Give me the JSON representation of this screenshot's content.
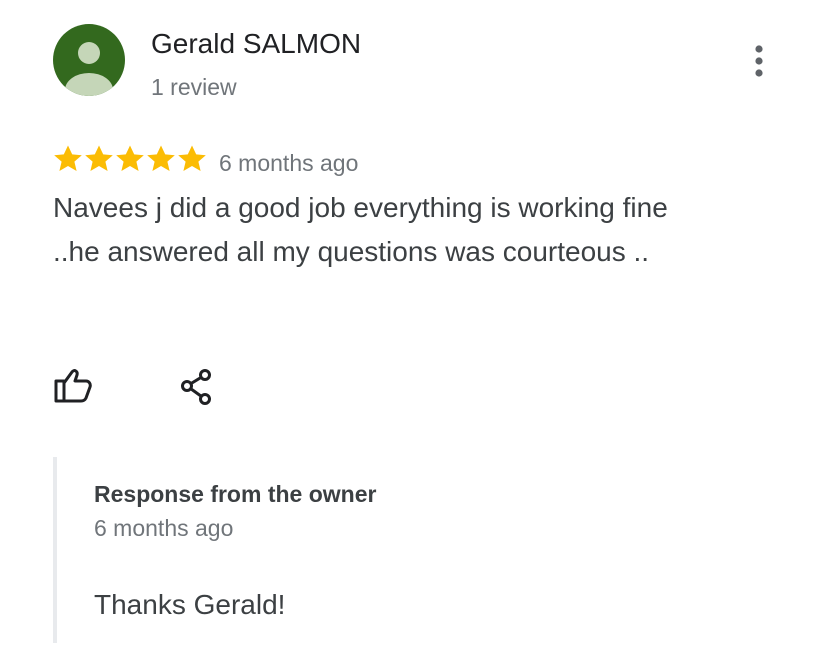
{
  "reviewer": {
    "name": "Gerald SALMON",
    "review_count": "1 review",
    "avatar_icon": "person-avatar-icon",
    "avatar_color": "#33691e"
  },
  "review": {
    "rating": 5,
    "rating_max": 5,
    "star_color": "#fbbc04",
    "date": "6 months ago",
    "text": "Navees j did a good job everything is working fine ..he answered all my questions was courteous .."
  },
  "actions": {
    "more_icon": "more-vert-icon",
    "like_icon": "thumb-up-outline-icon",
    "share_icon": "share-icon"
  },
  "owner_response": {
    "title": "Response from the owner",
    "date": "6 months ago",
    "text": "Thanks Gerald!"
  }
}
